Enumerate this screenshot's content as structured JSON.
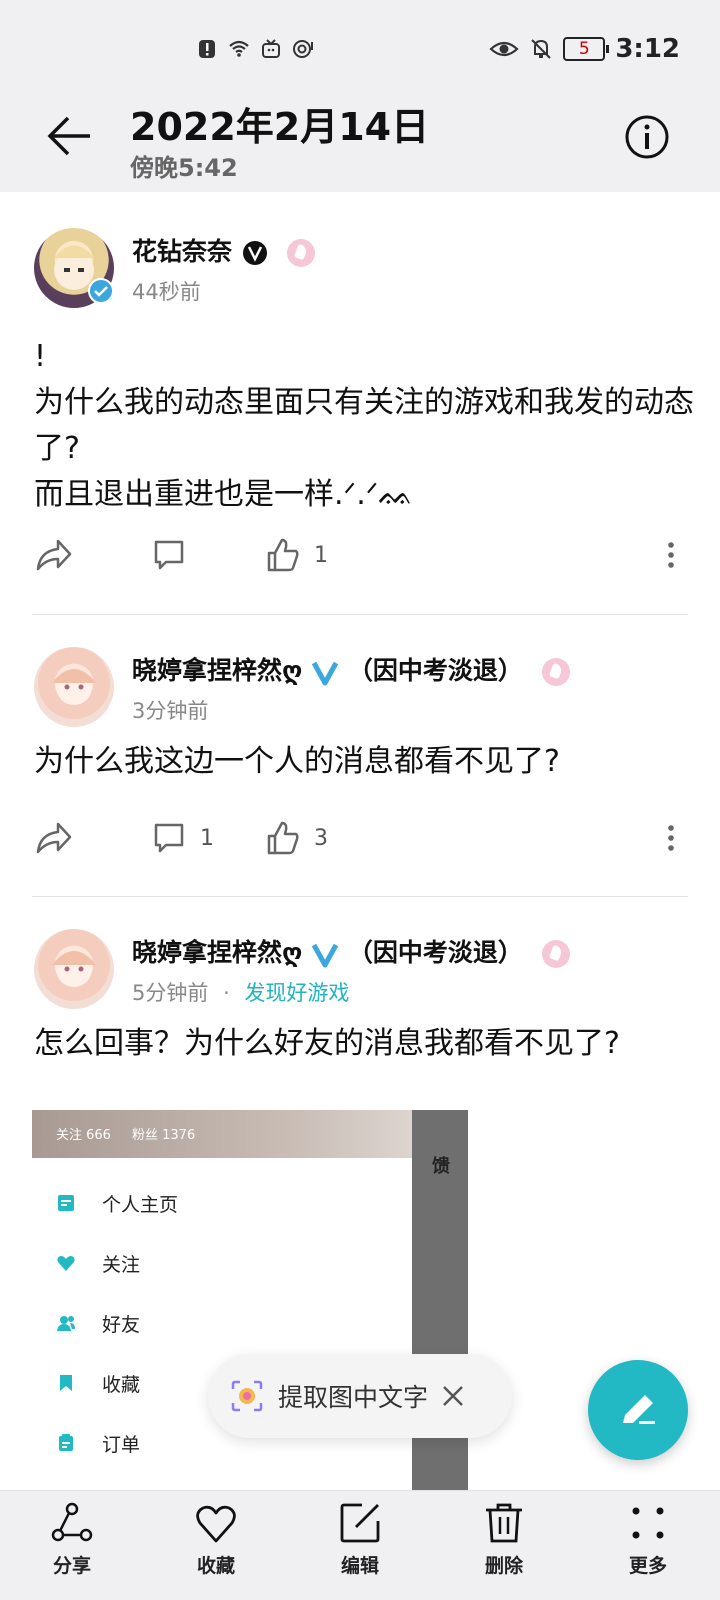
{
  "status_bar": {
    "time": "3:12",
    "battery": "5"
  },
  "header": {
    "title": "2022年2月14日",
    "subtitle": "傍晚5:42"
  },
  "posts": [
    {
      "username": "花钻奈奈",
      "time": "44秒前",
      "source": "",
      "text": "!\n为什么我的动态里面只有关注的游戏和我发的动态了?\n而且退出重进也是一样.ᐟ.ᐟᨐ",
      "comments": "",
      "likes": "1"
    },
    {
      "username": "晓婷拿捏梓然ღ",
      "username_suffix": "（因中考淡退）",
      "time": "3分钟前",
      "source": "",
      "text": "为什么我这边一个人的消息都看不见了?",
      "comments": "1",
      "likes": "3"
    },
    {
      "username": "晓婷拿捏梓然ღ",
      "username_suffix": "（因中考淡退）",
      "time": "5分钟前",
      "dot": "·",
      "source": "发现好游戏",
      "text": "怎么回事？为什么好友的消息我都看不见了?",
      "comments": "",
      "likes": ""
    }
  ],
  "embedded_screenshot": {
    "follow_stat": "关注 666",
    "fans_stat": "粉丝 1376",
    "side_text": "馈",
    "menu": [
      {
        "label": "个人主页",
        "icon": "profile-icon"
      },
      {
        "label": "关注",
        "icon": "heart-icon"
      },
      {
        "label": "好友",
        "icon": "friends-icon"
      },
      {
        "label": "收藏",
        "icon": "bookmark-icon"
      },
      {
        "label": "订单",
        "icon": "order-icon"
      }
    ]
  },
  "toast": {
    "label": "提取图中文字"
  },
  "bottom_bar": {
    "share": "分享",
    "favorite": "收藏",
    "edit": "编辑",
    "delete": "删除",
    "more": "更多"
  },
  "colors": {
    "accent": "#22b9c4",
    "link": "#1fb4c0",
    "verified_blue": "#3aa7de"
  }
}
